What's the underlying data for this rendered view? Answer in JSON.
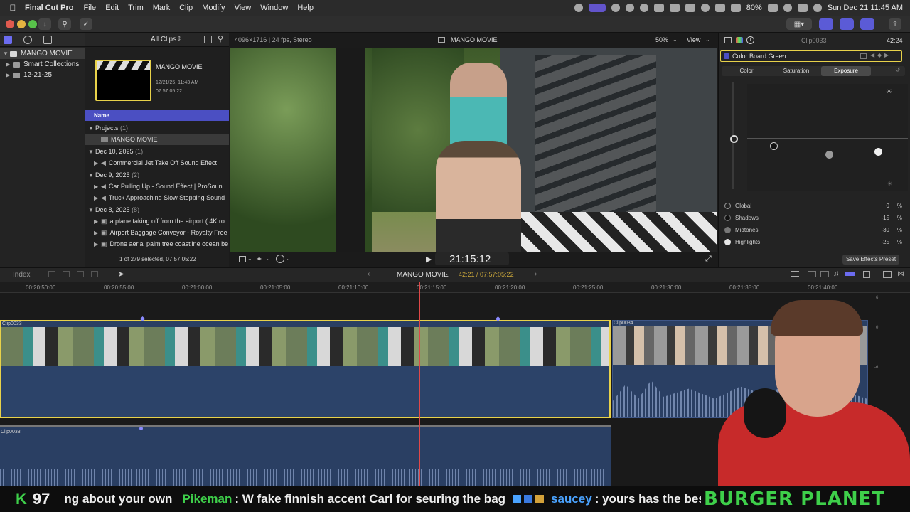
{
  "menubar": {
    "app_name": "Final Cut Pro",
    "items": [
      "File",
      "Edit",
      "Trim",
      "Mark",
      "Clip",
      "Modify",
      "View",
      "Window",
      "Help"
    ],
    "battery": "80%",
    "datetime": "Sun Dec 21  11:45 AM"
  },
  "libraries": {
    "items": [
      {
        "label": "MANGO MOVIE"
      },
      {
        "label": "Smart Collections"
      },
      {
        "label": "12-21-25"
      }
    ]
  },
  "browser": {
    "filter": "All Clips",
    "project_card": {
      "title": "MANGO MOVIE",
      "date": "12/21/25, 11:43 AM",
      "duration": "07:57:05:22"
    },
    "column_header": "Name",
    "groups": [
      {
        "label": "Projects",
        "count": "(1)",
        "items": [
          "MANGO MOVIE"
        ]
      },
      {
        "label": "Dec 10, 2025",
        "count": "(1)",
        "items": [
          "Commercial Jet Take Off Sound Effect"
        ]
      },
      {
        "label": "Dec 9, 2025",
        "count": "(2)",
        "items": [
          "Car Pulling Up - Sound Effect  |  ProSoun",
          "Truck Approaching Slow Stopping Sound"
        ]
      },
      {
        "label": "Dec 8, 2025",
        "count": "(8)",
        "items": [
          "a plane taking off from the airport ( 4K ro",
          "Airport Baggage Conveyor - Royalty Free",
          "Drone aerial palm tree coastline ocean be"
        ]
      }
    ],
    "status": "1 of 279 selected, 07:57:05:22"
  },
  "viewer": {
    "format": "4096×1716 | 24 fps, Stereo",
    "title": "MANGO MOVIE",
    "zoom": "50%",
    "view_label": "View",
    "timecode": "21:15:12"
  },
  "inspector": {
    "clip_name": "Clip0033",
    "clip_duration": "42:24",
    "effect_name": "Color Board Green",
    "tabs": [
      "Color",
      "Saturation",
      "Exposure"
    ],
    "active_tab": "Exposure",
    "rows": [
      {
        "label": "Global",
        "value": "0",
        "unit": "%"
      },
      {
        "label": "Shadows",
        "value": "-15",
        "unit": "%"
      },
      {
        "label": "Midtones",
        "value": "-30",
        "unit": "%"
      },
      {
        "label": "Highlights",
        "value": "-25",
        "unit": "%"
      }
    ],
    "save_preset": "Save Effects Preset"
  },
  "timeline": {
    "index_label": "Index",
    "project_name": "MANGO MOVIE",
    "position": "42:21 / 07:57:05:22",
    "ruler": [
      "00:20:50:00",
      "00:20:55:00",
      "00:21:00:00",
      "00:21:05:00",
      "00:21:10:00",
      "00:21:15:00",
      "00:21:20:00",
      "00:21:25:00",
      "00:21:30:00",
      "00:21:35:00",
      "00:21:40:00"
    ],
    "clips": [
      {
        "name": "Clip0033"
      },
      {
        "name": "Clip0034"
      },
      {
        "name": "Clip0033"
      }
    ],
    "meter_labels": [
      "6",
      "0",
      "-6"
    ]
  },
  "ticker": {
    "count_prefix": "K",
    "count": "97",
    "text1": "ng about your own",
    "user1": "Pikeman",
    "msg1": ": W fake finnish accent Carl for seuring the bag",
    "user2": "saucey",
    "msg2": ": yours has the best flow",
    "brand": "BURGER PLANET"
  },
  "colors": {
    "accent_purple": "#5b5bd6",
    "clip_blue": "#2a3f63",
    "selection_yellow": "#e8d24a",
    "playhead_red": "#e04848",
    "ticker_green": "#3ecf4a",
    "ticker_blue": "#4aa3ff"
  }
}
